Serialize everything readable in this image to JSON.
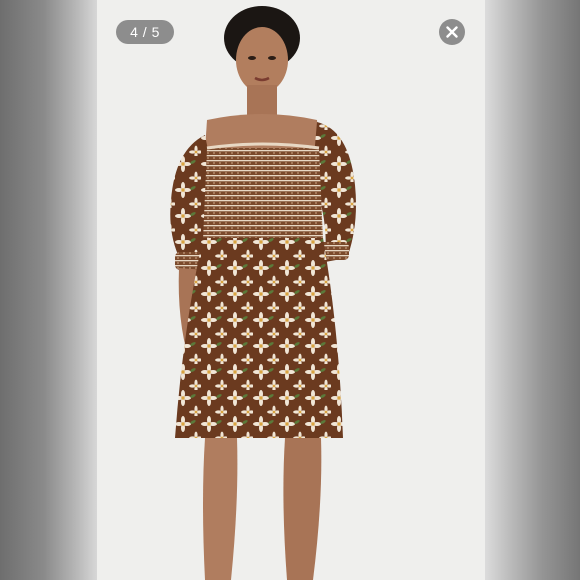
{
  "viewer": {
    "counter_text": "4 / 5",
    "close_icon": "close-icon",
    "image_subject": "model-in-floral-smocked-mini-dress"
  },
  "colors": {
    "overlay_bg": "#7a7a7a",
    "photo_bg": "#efefed",
    "dress_brown": "#6b3a1f",
    "daisy_cream": "#f1e6d6",
    "leaf_green": "#5b7a3a"
  }
}
